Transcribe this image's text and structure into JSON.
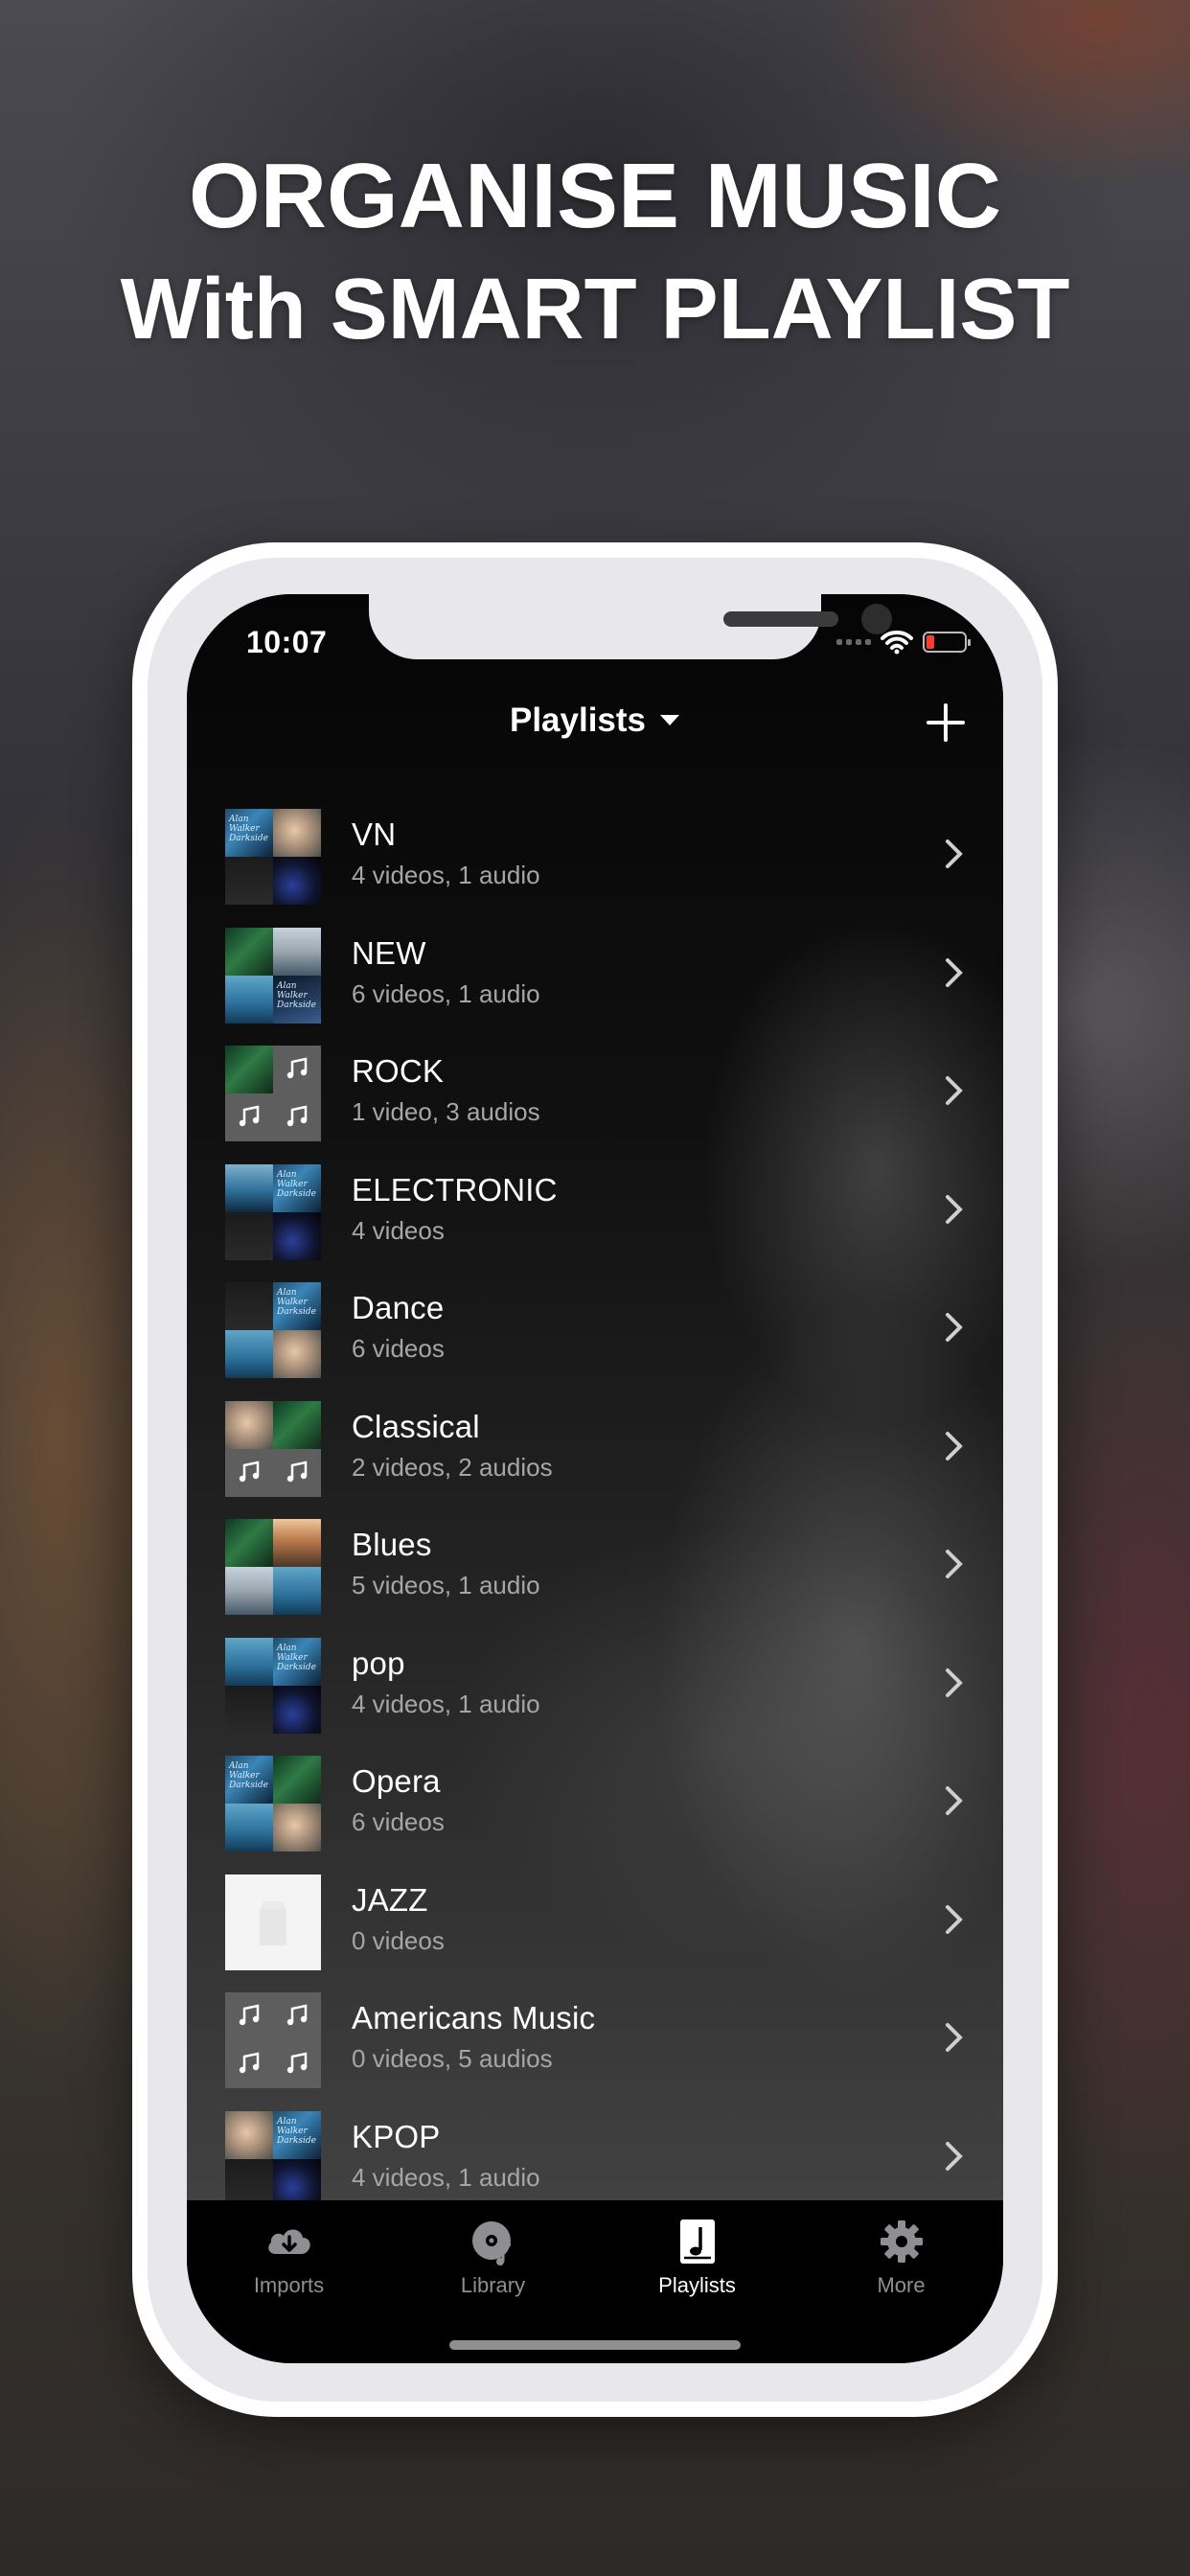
{
  "headline": {
    "line1": "ORGANISE MUSIC",
    "line2": "With SMART PLAYLIST"
  },
  "status_bar": {
    "time": "10:07",
    "battery_color": "#ff3b30"
  },
  "navigation": {
    "title": "Playlists",
    "title_icon": "chevron-down-icon",
    "add_icon": "plus-icon"
  },
  "playlists": [
    {
      "name": "VN",
      "summary": "4 videos, 1 audio"
    },
    {
      "name": "NEW",
      "summary": "6 videos, 1 audio"
    },
    {
      "name": "ROCK",
      "summary": "1 video, 3 audios"
    },
    {
      "name": "ELECTRONIC",
      "summary": "4 videos"
    },
    {
      "name": "Dance",
      "summary": "6 videos"
    },
    {
      "name": "Classical",
      "summary": "2 videos, 2 audios"
    },
    {
      "name": "Blues",
      "summary": "5 videos, 1 audio"
    },
    {
      "name": "pop",
      "summary": "4 videos, 1 audio"
    },
    {
      "name": "Opera",
      "summary": "6 videos"
    },
    {
      "name": "JAZZ",
      "summary": "0 videos"
    },
    {
      "name": "Americans Music",
      "summary": "0 videos, 5 audios"
    },
    {
      "name": "KPOP",
      "summary": "4 videos, 1 audio"
    }
  ],
  "tabbar": {
    "tabs": [
      {
        "label": "Imports",
        "icon": "cloud-download-icon"
      },
      {
        "label": "Library",
        "icon": "disc-icon"
      },
      {
        "label": "Playlists",
        "icon": "playlist-icon",
        "active": true
      },
      {
        "label": "More",
        "icon": "gear-icon"
      }
    ]
  },
  "colors": {
    "screen_background": "#060606",
    "text_primary": "#ffffff",
    "text_secondary": "#a6a6a6",
    "tab_inactive": "#8e8e93"
  }
}
